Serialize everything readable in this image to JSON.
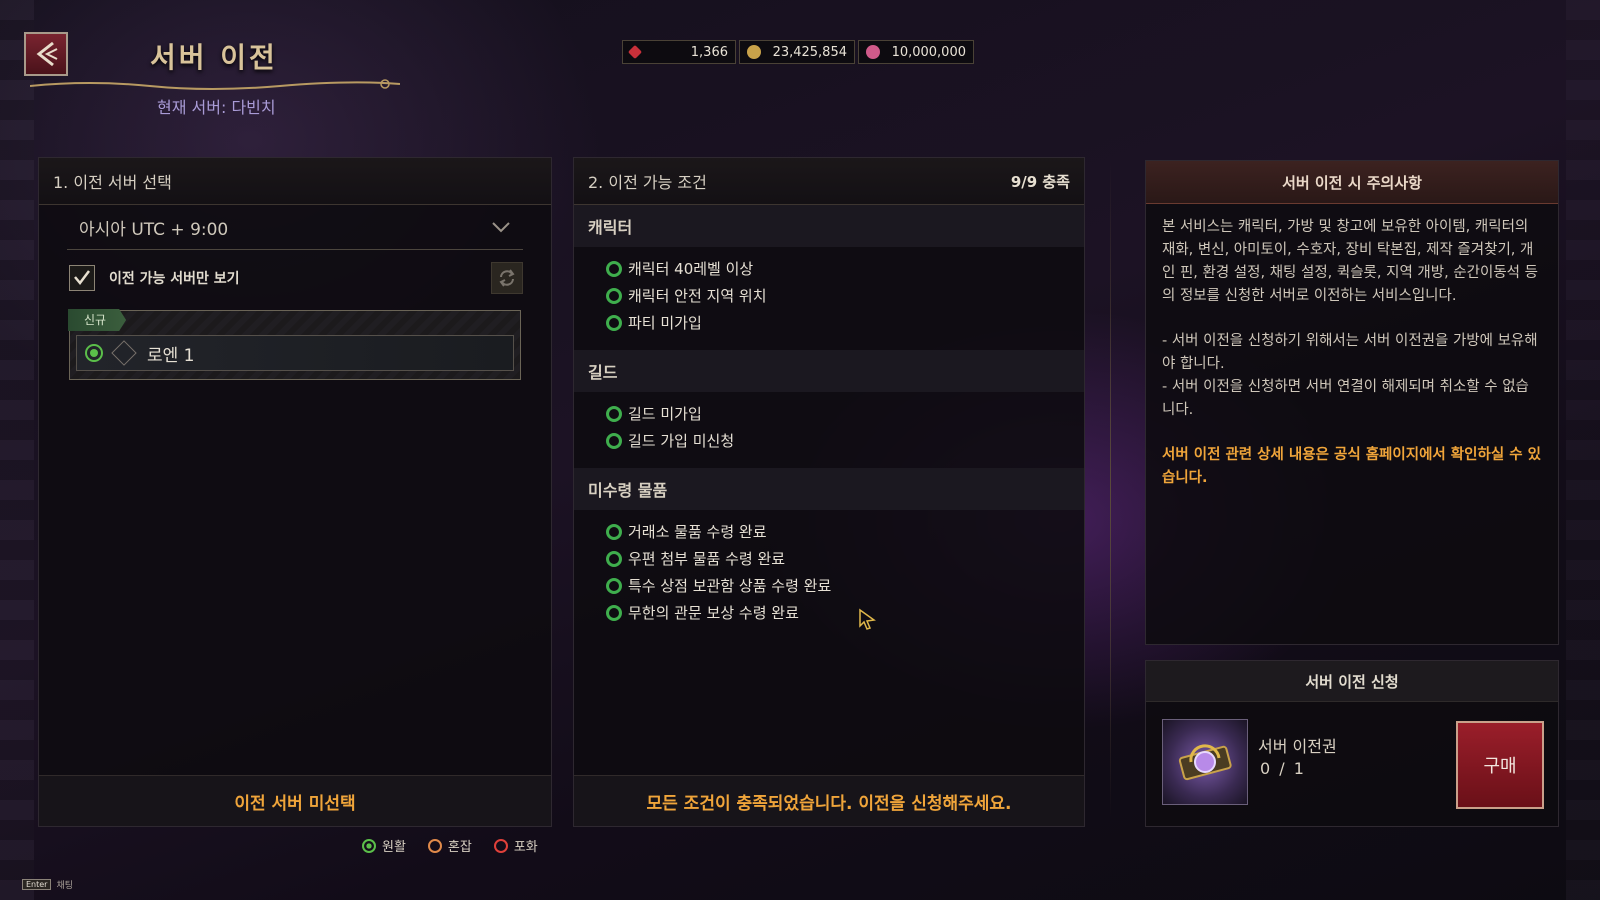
{
  "header": {
    "title": "서버 이전",
    "current_server": "현재 서버: 다빈치",
    "currencies": [
      {
        "icon": "ruby-icon",
        "value": "1,366",
        "color": "#c8303a"
      },
      {
        "icon": "gold-icon",
        "value": "23,425,854",
        "color": "#c9a24a"
      },
      {
        "icon": "pink-gem-icon",
        "value": "10,000,000",
        "color": "#d05a8a"
      }
    ]
  },
  "select_panel": {
    "title": "1. 이전 서버 선택",
    "region": "아시아 UTC + 9:00",
    "filter_label": "이전 가능 서버만 보기",
    "filter_checked": true,
    "servers": [
      {
        "tag": "신규",
        "name": "로엔 1",
        "status": "원활"
      }
    ],
    "footer": "이전 서버 미선택"
  },
  "cond_panel": {
    "title": "2. 이전 가능 조건",
    "count": "9/9 충족",
    "sections": [
      {
        "title": "캐릭터",
        "items": [
          "캐릭터 40레벨 이상",
          "캐릭터 안전 지역 위치",
          "파티 미가입"
        ]
      },
      {
        "title": "길드",
        "items": [
          "길드 미가입",
          "길드 가입 미신청"
        ]
      },
      {
        "title": "미수령 물품",
        "items": [
          "거래소 물품 수령 완료",
          "우편 첨부 물품 수령 완료",
          "특수 상점 보관함 상품 수령 완료",
          "무한의 관문 보상 수령 완료"
        ]
      }
    ],
    "footer": "모든 조건이 충족되었습니다. 이전을 신청해주세요."
  },
  "notice": {
    "title": "서버 이전 시 주의사항",
    "p1": "본 서비스는 캐릭터, 가방 및 창고에 보유한 아이템, 캐릭터의 재화, 변신, 아미토이, 수호자, 장비 탁본집, 제작 즐겨찾기, 개인 핀, 환경 설정, 채팅 설정, 퀵슬롯, 지역 개방, 순간이동석 등의 정보를 신청한 서버로 이전하는 서비스입니다.",
    "p2": "- 서버 이전을 신청하기 위해서는 서버 이전권을 가방에 보유해야 합니다.",
    "p3": "- 서버 이전을 신청하면 서버 연결이 해제되며 취소할 수 없습니다.",
    "highlight": "서버 이전 관련 상세 내용은 공식 홈페이지에서 확인하실 수 있습니다."
  },
  "apply": {
    "title": "서버 이전 신청",
    "ticket_name": "서버 이전권",
    "ticket_count": "0 / 1",
    "buy_label": "구매"
  },
  "legend": [
    {
      "label": "원활",
      "color": "#5bbf4a"
    },
    {
      "label": "혼잡",
      "color": "#e08a4a"
    },
    {
      "label": "포화",
      "color": "#e0403a"
    }
  ],
  "hint": {
    "key": "Enter",
    "label": "채팅"
  }
}
